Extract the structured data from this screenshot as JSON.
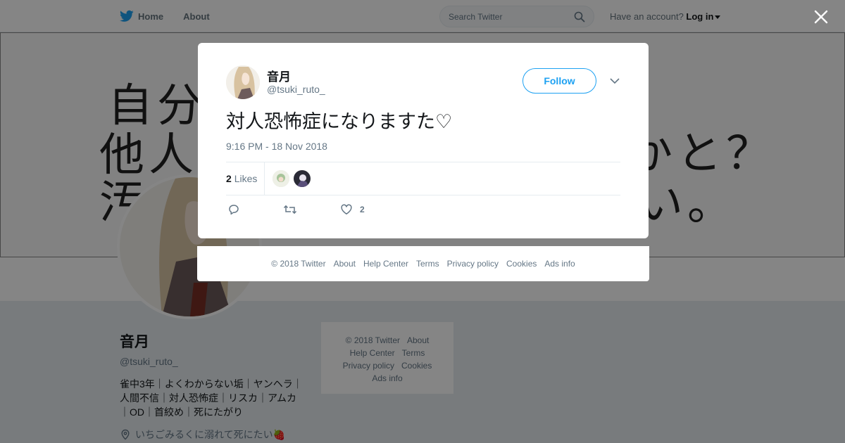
{
  "topbar": {
    "nav": [
      {
        "label": "Home",
        "icon": "twitter-bird-icon"
      },
      {
        "label": "About"
      }
    ],
    "search_placeholder": "Search Twitter",
    "account_prompt": "Have an account?",
    "login_label": "Log in"
  },
  "banner": {
    "lines": [
      "自分",
      "他人",
      "汚",
      "かと？",
      "い。"
    ]
  },
  "profile": {
    "name": "音月",
    "handle": "@tsuki_ruto_",
    "bio": [
      "雀中3年｜よくわからない垢｜ヤンヘラ｜",
      "人間不信｜対人恐怖症｜リスカ｜アムカ",
      "｜OD｜首絞め｜死にたがり"
    ],
    "location": "いちごみるくに溺れて死にたい🍓"
  },
  "sidebar_footer": {
    "rows": [
      [
        "© 2018 Twitter",
        "About"
      ],
      [
        "Help Center",
        "Terms"
      ],
      [
        "Privacy policy",
        "Cookies"
      ],
      [
        "Ads info"
      ]
    ]
  },
  "tweet": {
    "name": "音月",
    "handle": "@tsuki_ruto_",
    "follow_label": "Follow",
    "text": "対人恐怖症になりますた♡",
    "timestamp": "9:16 PM - 18 Nov 2018",
    "likes_count": "2",
    "likes_label": "Likes",
    "like_action_count": "2"
  },
  "modal_footer": {
    "links": [
      "© 2018 Twitter",
      "About",
      "Help Center",
      "Terms",
      "Privacy policy",
      "Cookies",
      "Ads info"
    ]
  },
  "colors": {
    "brand": "#1da1f2",
    "secondary_text": "#657786",
    "backdrop": "#e6ecf0"
  }
}
